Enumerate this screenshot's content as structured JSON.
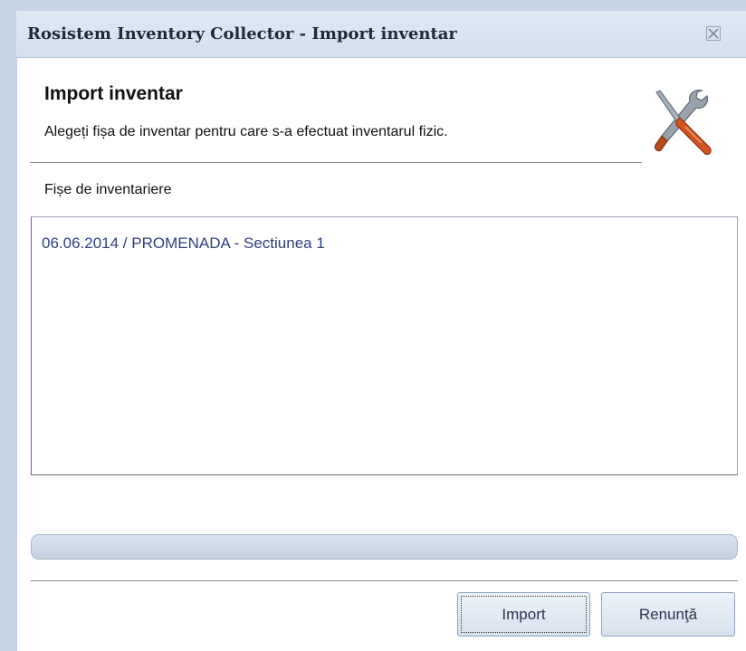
{
  "window": {
    "title": "Rosistem Inventory Collector - Import inventar",
    "close_icon": "close-icon"
  },
  "header": {
    "heading": "Import inventar",
    "description": "Alegeți fișa de inventar pentru care s-a efectuat inventarul fizic.",
    "icon": "tools-icon"
  },
  "list": {
    "label": "Fișe de inventariere",
    "items": [
      "06.06.2014 / PROMENADA - Sectiunea 1"
    ]
  },
  "progress": {
    "value": 0
  },
  "buttons": {
    "import_label": "Import",
    "cancel_label": "Renunţă"
  },
  "colors": {
    "title_bar": "#dfe9f5",
    "list_item_text": "#2f3f7c",
    "button_bg": "#e3eaf4"
  }
}
